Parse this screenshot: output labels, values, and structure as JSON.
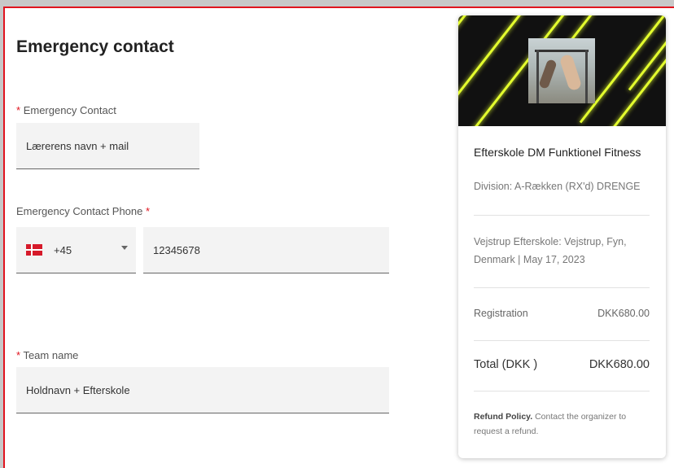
{
  "form": {
    "title": "Emergency contact",
    "emergency_contact": {
      "required_mark": "*",
      "label": "Emergency Contact",
      "value": "Lærerens navn + mail"
    },
    "phone": {
      "label": "Emergency Contact Phone",
      "required_mark": "*",
      "country_flag": "denmark-flag",
      "country_code": "+45",
      "number": "12345678"
    },
    "team_name": {
      "required_mark": "*",
      "label": "Team name",
      "value": "Holdnavn + Efterskole"
    }
  },
  "summary": {
    "event_name": "Efterskole DM Funktionel Fitness",
    "division": "Division: A-Rækken (RX'd) DRENGE",
    "location": "Vejstrup Efterskole: Vejstrup, Fyn, Denmark | May 17, 2023",
    "registration_label": "Registration",
    "registration_value": "DKK680.00",
    "total_label": "Total (DKK )",
    "total_value": "DKK680.00",
    "refund_title": "Refund Policy.",
    "refund_text": "Contact the organizer to request a refund."
  },
  "colors": {
    "required": "#e0141e",
    "banner_stripe": "#e4ff2e",
    "field_bg": "#f3f3f3"
  }
}
